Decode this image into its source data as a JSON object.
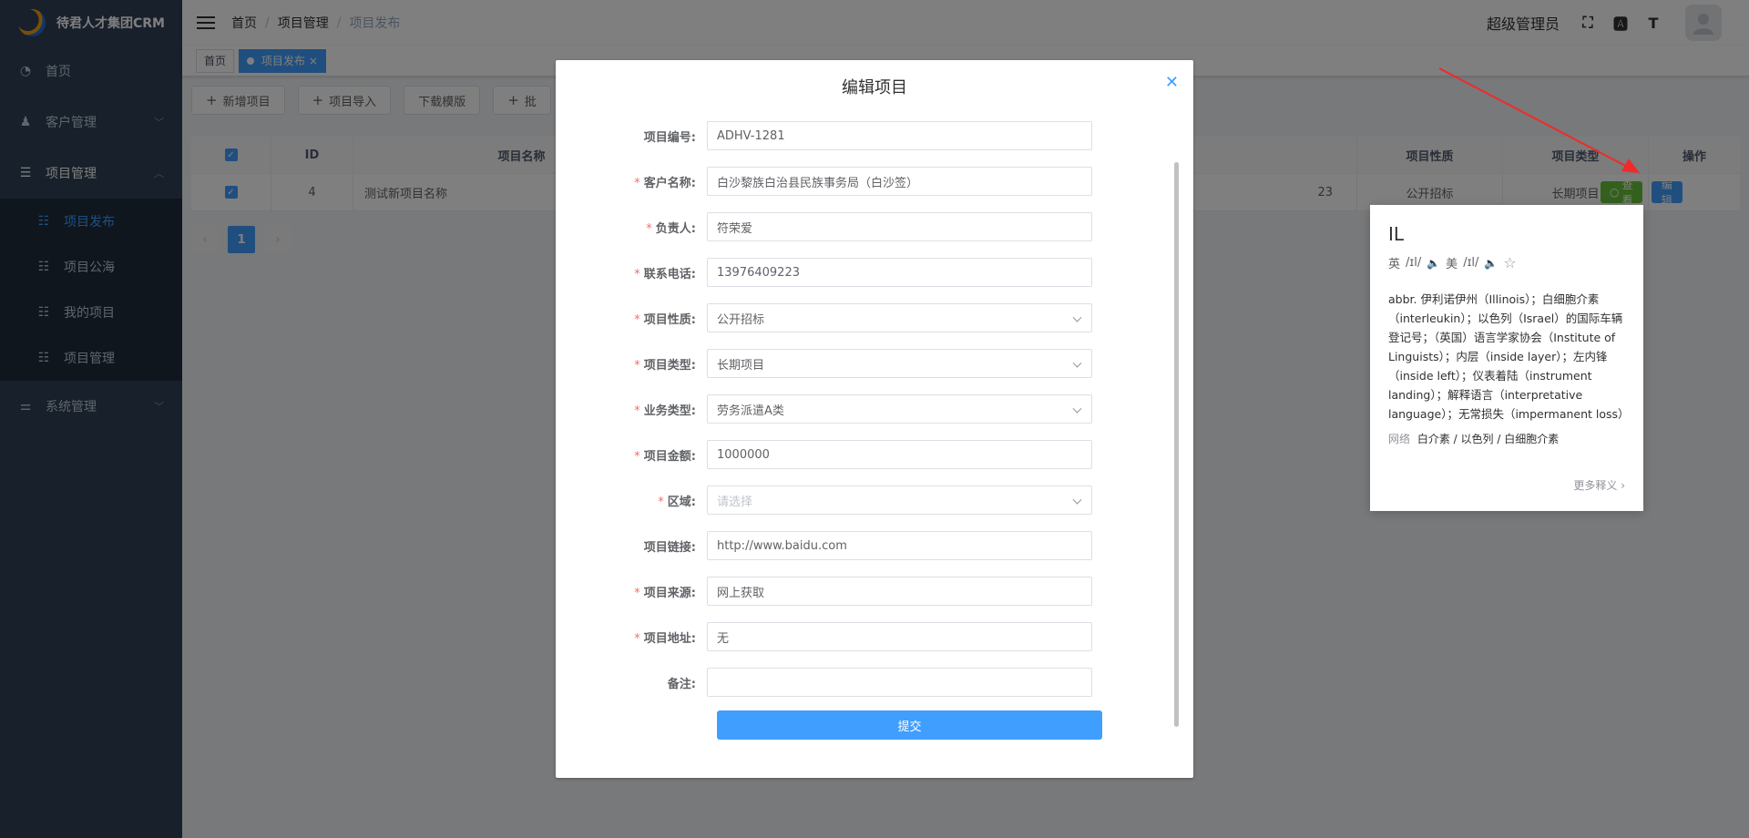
{
  "app": {
    "title": "待君人才集团CRM"
  },
  "sidebar": {
    "items": [
      {
        "label": "首页",
        "icon": "dashboard-icon"
      },
      {
        "label": "客户管理",
        "icon": "users-icon"
      },
      {
        "label": "项目管理",
        "icon": "list-icon"
      },
      {
        "label": "系统管理",
        "icon": "sliders-icon"
      }
    ],
    "sub_items": [
      {
        "label": "项目发布"
      },
      {
        "label": "项目公海"
      },
      {
        "label": "我的项目"
      },
      {
        "label": "项目管理"
      }
    ]
  },
  "header": {
    "breadcrumb": [
      "首页",
      "项目管理",
      "项目发布"
    ],
    "username": "超级管理员"
  },
  "tags": [
    {
      "label": "首页"
    },
    {
      "label": "项目发布"
    }
  ],
  "toolbar": {
    "add_label": "新增项目",
    "import_label": "项目导入",
    "download_label": "下载模版",
    "batch_label": "批"
  },
  "table": {
    "headers": {
      "id": "ID",
      "name": "项目名称",
      "nature": "项目性质",
      "type": "项目类型",
      "ops": "操作"
    },
    "row": {
      "id": "4",
      "name": "测试新项目名称",
      "phone_tail": "23",
      "nature": "公开招标",
      "type": "长期项目"
    },
    "view_label": "查看",
    "edit_label": "编辑"
  },
  "pager": {
    "current": "1"
  },
  "dialog": {
    "title": "编辑项目",
    "fields": [
      {
        "label": "项目编号:",
        "value": "ADHV-1281"
      },
      {
        "label": "客户名称:",
        "value": "白沙黎族白治县民族事务局（白沙签）"
      },
      {
        "label": "负责人:",
        "value": "符荣爱"
      },
      {
        "label": "联系电话:",
        "value": "13976409223"
      },
      {
        "label": "项目性质:",
        "value": "公开招标"
      },
      {
        "label": "项目类型:",
        "value": "长期项目"
      },
      {
        "label": "业务类型:",
        "value": "劳务派遣A类"
      },
      {
        "label": "项目金额:",
        "value": "1000000"
      },
      {
        "label": "区域:",
        "placeholder": "请选择"
      },
      {
        "label": "项目链接:",
        "value": "http://www.baidu.com"
      },
      {
        "label": "项目来源:",
        "value": "网上获取"
      },
      {
        "label": "项目地址:",
        "value": "无"
      },
      {
        "label": "备注:",
        "value": ""
      }
    ],
    "submit_label": "提交"
  },
  "dict": {
    "word": "IL",
    "uk_label": "英",
    "us_label": "美",
    "phonetic": "/ɪl/",
    "definition": "abbr. 伊利诺伊州（Illinois）；白细胞介素（interleukin）；以色列（Israel）的国际车辆登记号；（英国）语言学家协会（Institute of Linguists）；内层（inside layer）；左内锋（inside left）；仪表着陆（instrument landing）；解释语言（interpretative language）；无常损失（impermanent loss）",
    "net_label": "网络",
    "net_value": "白介素 / 以色列 / 白细胞介素",
    "more_label": "更多释义 ›"
  }
}
